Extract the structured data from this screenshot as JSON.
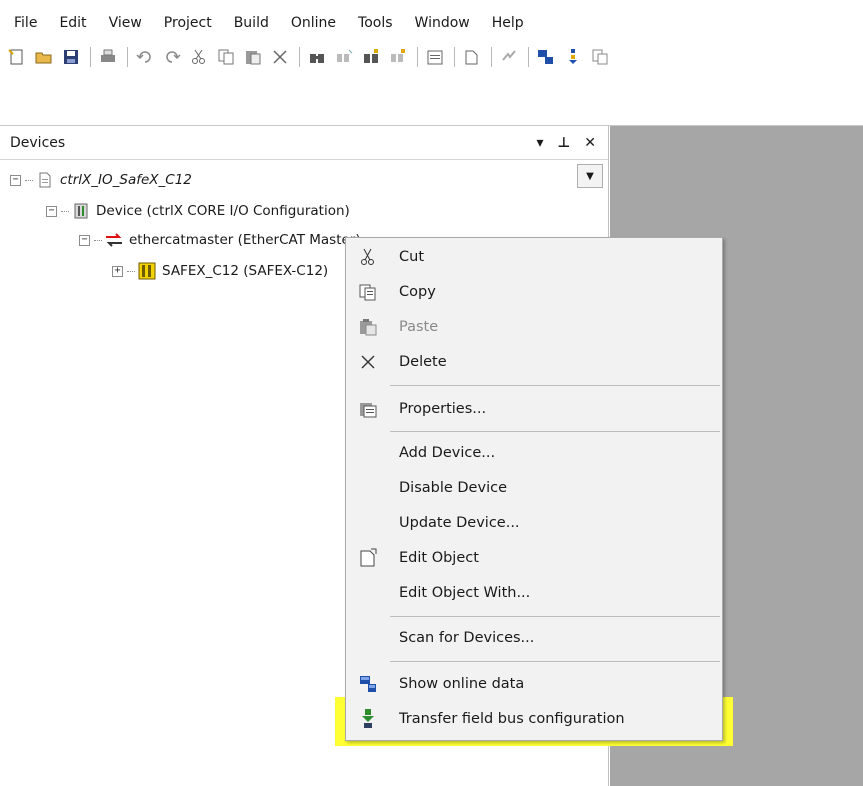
{
  "menu": [
    "File",
    "Edit",
    "View",
    "Project",
    "Build",
    "Online",
    "Tools",
    "Window",
    "Help"
  ],
  "panel": {
    "title": "Devices",
    "controls": [
      "▾",
      "⊥",
      "✕"
    ]
  },
  "tree": [
    {
      "label": "ctrlX_IO_SafeX_C12",
      "expander": "−"
    },
    {
      "label": "Device (ctrlX CORE I/O Configuration)",
      "expander": "−"
    },
    {
      "label": "ethercatmaster (EtherCAT Master)",
      "expander": "−"
    },
    {
      "label": "SAFEX_C12 (SAFEX-C12)",
      "expander": "+"
    }
  ],
  "context_menu": [
    {
      "label": "Cut",
      "icon": "scissors-icon",
      "enabled": true
    },
    {
      "label": "Copy",
      "icon": "copy-icon",
      "enabled": true
    },
    {
      "label": "Paste",
      "icon": "paste-icon",
      "enabled": false
    },
    {
      "label": "Delete",
      "icon": "delete-icon",
      "enabled": true
    },
    {
      "label": "Properties...",
      "icon": "properties-icon",
      "enabled": true
    },
    {
      "label": "Add Device...",
      "icon": "",
      "enabled": true
    },
    {
      "label": "Disable Device",
      "icon": "",
      "enabled": true
    },
    {
      "label": "Update Device...",
      "icon": "",
      "enabled": true
    },
    {
      "label": "Edit Object",
      "icon": "edit-object-icon",
      "enabled": true
    },
    {
      "label": "Edit Object With...",
      "icon": "",
      "enabled": true
    },
    {
      "label": "Scan for Devices...",
      "icon": "",
      "enabled": true
    },
    {
      "label": "Show online data",
      "icon": "online-data-icon",
      "enabled": true
    },
    {
      "label": "Transfer field bus configuration",
      "icon": "transfer-config-icon",
      "enabled": true
    }
  ],
  "colors": {
    "highlight": "#ffff33",
    "menu_bg": "#f2f2f2",
    "right_panel": "#a6a6a6"
  }
}
